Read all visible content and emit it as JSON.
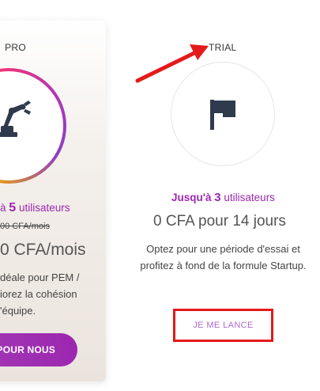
{
  "pro_plan": {
    "title": "PRO",
    "users_prefix": "à",
    "users_count": "5",
    "users_suffix": "utilisateurs",
    "old_price": "00 CFA/mois",
    "price": "0 CFA/mois",
    "description_lines": [
      "déale pour PEM /",
      "iorez la cohésion",
      "'équipe."
    ],
    "button_label": "POUR NOUS",
    "icon": "robot-arm-icon",
    "ring_colors": [
      "#e9357d",
      "#b036b8",
      "#f5a300",
      "#f26a2e"
    ]
  },
  "trial_plan": {
    "title": "TRIAL",
    "users_prefix": "Jusqu'à",
    "users_count": "3",
    "users_suffix": "utilisateurs",
    "price": "0 CFA pour 14 jours",
    "description": "Optez pour une période d'essai et profitez à fond de la formule Startup.",
    "button_label": "JE ME LANCE",
    "icon": "flag-icon"
  },
  "annotation": {
    "color": "#e41a1a"
  },
  "colors": {
    "accent": "#9c27b0",
    "icon": "#2f3a4d"
  }
}
